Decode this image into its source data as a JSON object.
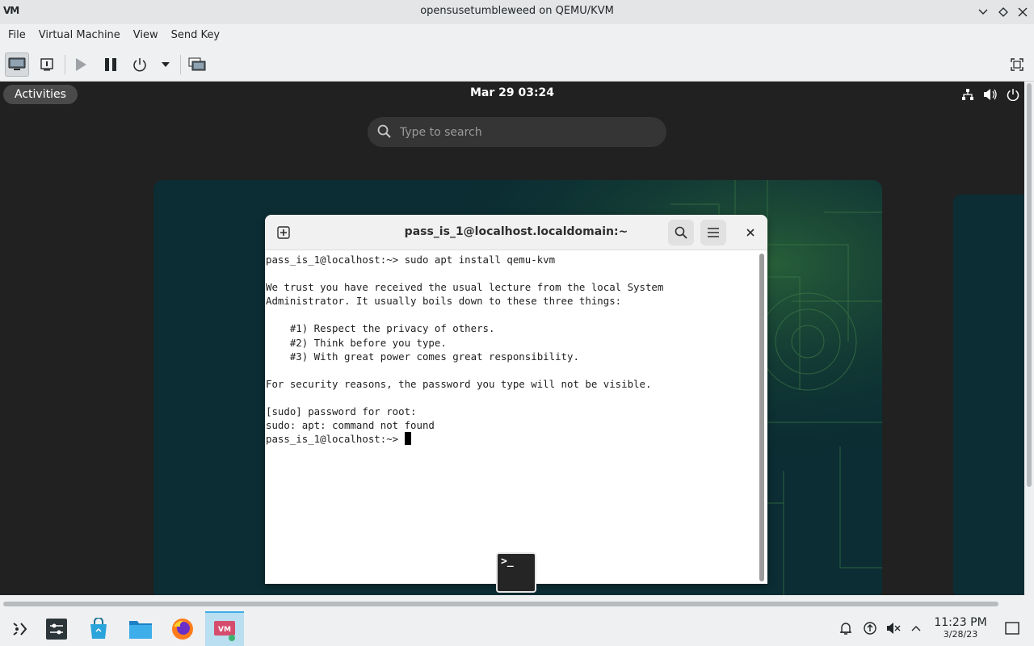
{
  "window": {
    "title": "opensusetumbleweed on QEMU/KVM",
    "logo": "VM"
  },
  "menubar": {
    "items": [
      "File",
      "Virtual Machine",
      "View",
      "Send Key"
    ]
  },
  "toolbar": {
    "icons": [
      "console-icon",
      "details-icon",
      "run-icon",
      "pause-icon",
      "power-icon",
      "power-menu-icon",
      "snapshot-icon",
      "fullscreen-icon"
    ]
  },
  "guest": {
    "topbar": {
      "activities": "Activities",
      "clock": "Mar 29  03:24"
    },
    "search": {
      "placeholder": "Type to search"
    },
    "terminal": {
      "title": "pass_is_1@localhost.localdomain:~",
      "lines": [
        "pass_is_1@localhost:~> sudo apt install qemu-kvm",
        "",
        "We trust you have received the usual lecture from the local System",
        "Administrator. It usually boils down to these three things:",
        "",
        "    #1) Respect the privacy of others.",
        "    #2) Think before you type.",
        "    #3) With great power comes great responsibility.",
        "",
        "For security reasons, the password you type will not be visible.",
        "",
        "[sudo] password for root:",
        "sudo: apt: command not found"
      ],
      "prompt": "pass_is_1@localhost:~> "
    },
    "launcher_glyph": ">_"
  },
  "taskbar": {
    "time": "11:23 PM",
    "date": "3/28/23"
  },
  "colors": {
    "accent": "#3daee9",
    "guest_bg": "#212121",
    "wallpaper": "#0b2d33"
  }
}
